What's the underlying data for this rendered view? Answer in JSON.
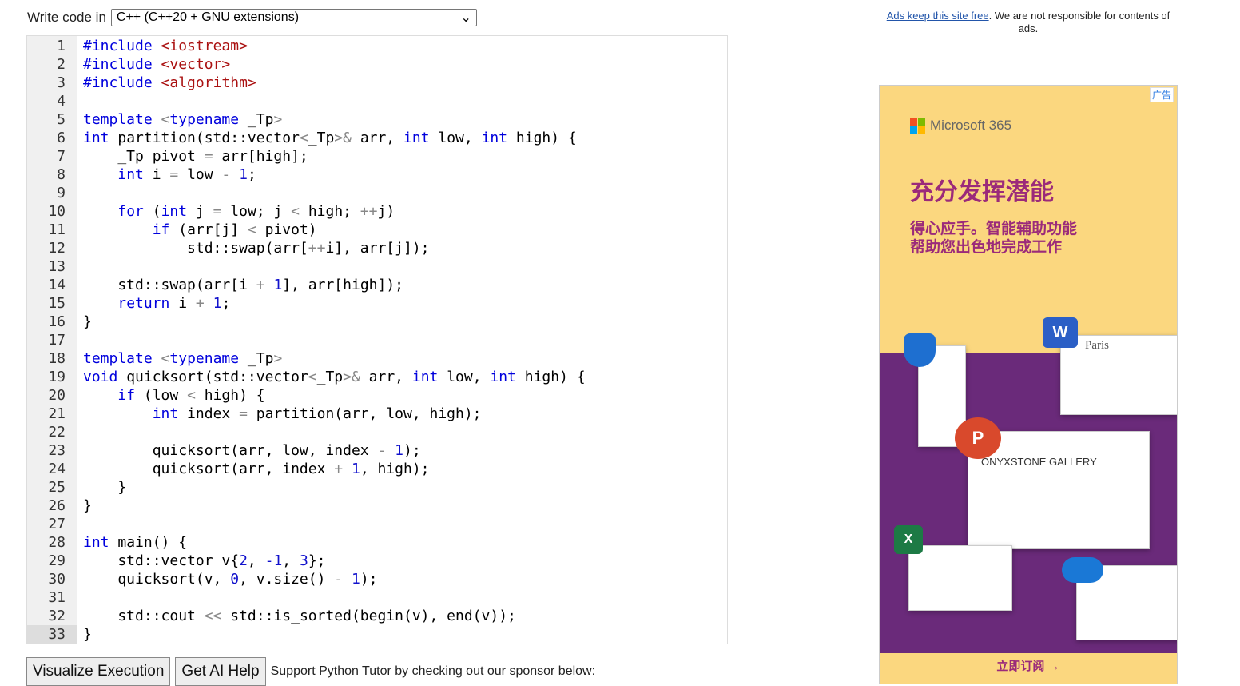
{
  "header": {
    "label": "Write code in",
    "language": "C++ (C++20 + GNU extensions)"
  },
  "editor": {
    "active_line": 33,
    "lines": [
      [
        [
          "k",
          "#include "
        ],
        [
          "s",
          "<iostream>"
        ]
      ],
      [
        [
          "k",
          "#include "
        ],
        [
          "s",
          "<vector>"
        ]
      ],
      [
        [
          "k",
          "#include "
        ],
        [
          "s",
          "<algorithm>"
        ]
      ],
      [],
      [
        [
          "k",
          "template "
        ],
        [
          "o",
          "<"
        ],
        [
          "k",
          "typename"
        ],
        [
          "p",
          " _Tp"
        ],
        [
          "o",
          ">"
        ]
      ],
      [
        [
          "k",
          "int"
        ],
        [
          "p",
          " partition(std::vector"
        ],
        [
          "o",
          "<"
        ],
        [
          "p",
          "_Tp"
        ],
        [
          "o",
          ">&"
        ],
        [
          "p",
          " arr, "
        ],
        [
          "k",
          "int"
        ],
        [
          "p",
          " low, "
        ],
        [
          "k",
          "int"
        ],
        [
          "p",
          " high) {"
        ]
      ],
      [
        [
          "p",
          "    _Tp pivot "
        ],
        [
          "o",
          "="
        ],
        [
          "p",
          " arr[high];"
        ]
      ],
      [
        [
          "p",
          "    "
        ],
        [
          "k",
          "int"
        ],
        [
          "p",
          " i "
        ],
        [
          "o",
          "="
        ],
        [
          "p",
          " low "
        ],
        [
          "o",
          "-"
        ],
        [
          "p",
          " "
        ],
        [
          "n",
          "1"
        ],
        [
          "p",
          ";"
        ]
      ],
      [],
      [
        [
          "p",
          "    "
        ],
        [
          "k",
          "for"
        ],
        [
          "p",
          " ("
        ],
        [
          "k",
          "int"
        ],
        [
          "p",
          " j "
        ],
        [
          "o",
          "="
        ],
        [
          "p",
          " low; j "
        ],
        [
          "o",
          "<"
        ],
        [
          "p",
          " high; "
        ],
        [
          "o",
          "++"
        ],
        [
          "p",
          "j)"
        ]
      ],
      [
        [
          "p",
          "        "
        ],
        [
          "k",
          "if"
        ],
        [
          "p",
          " (arr[j] "
        ],
        [
          "o",
          "<"
        ],
        [
          "p",
          " pivot)"
        ]
      ],
      [
        [
          "p",
          "            std::swap(arr["
        ],
        [
          "o",
          "++"
        ],
        [
          "p",
          "i], arr[j]);"
        ]
      ],
      [],
      [
        [
          "p",
          "    std::swap(arr[i "
        ],
        [
          "o",
          "+"
        ],
        [
          "p",
          " "
        ],
        [
          "n",
          "1"
        ],
        [
          "p",
          "], arr[high]);"
        ]
      ],
      [
        [
          "p",
          "    "
        ],
        [
          "k",
          "return"
        ],
        [
          "p",
          " i "
        ],
        [
          "o",
          "+"
        ],
        [
          "p",
          " "
        ],
        [
          "n",
          "1"
        ],
        [
          "p",
          ";"
        ]
      ],
      [
        [
          "p",
          "}"
        ]
      ],
      [],
      [
        [
          "k",
          "template "
        ],
        [
          "o",
          "<"
        ],
        [
          "k",
          "typename"
        ],
        [
          "p",
          " _Tp"
        ],
        [
          "o",
          ">"
        ]
      ],
      [
        [
          "k",
          "void"
        ],
        [
          "p",
          " quicksort(std::vector"
        ],
        [
          "o",
          "<"
        ],
        [
          "p",
          "_Tp"
        ],
        [
          "o",
          ">&"
        ],
        [
          "p",
          " arr, "
        ],
        [
          "k",
          "int"
        ],
        [
          "p",
          " low, "
        ],
        [
          "k",
          "int"
        ],
        [
          "p",
          " high) {"
        ]
      ],
      [
        [
          "p",
          "    "
        ],
        [
          "k",
          "if"
        ],
        [
          "p",
          " (low "
        ],
        [
          "o",
          "<"
        ],
        [
          "p",
          " high) {"
        ]
      ],
      [
        [
          "p",
          "        "
        ],
        [
          "k",
          "int"
        ],
        [
          "p",
          " index "
        ],
        [
          "o",
          "="
        ],
        [
          "p",
          " partition(arr, low, high);"
        ]
      ],
      [],
      [
        [
          "p",
          "        quicksort(arr, low, index "
        ],
        [
          "o",
          "-"
        ],
        [
          "p",
          " "
        ],
        [
          "n",
          "1"
        ],
        [
          "p",
          ");"
        ]
      ],
      [
        [
          "p",
          "        quicksort(arr, index "
        ],
        [
          "o",
          "+"
        ],
        [
          "p",
          " "
        ],
        [
          "n",
          "1"
        ],
        [
          "p",
          ", high);"
        ]
      ],
      [
        [
          "p",
          "    }"
        ]
      ],
      [
        [
          "p",
          "}"
        ]
      ],
      [],
      [
        [
          "k",
          "int"
        ],
        [
          "p",
          " main() {"
        ]
      ],
      [
        [
          "p",
          "    std::vector v{"
        ],
        [
          "n",
          "2"
        ],
        [
          "p",
          ", "
        ],
        [
          "n",
          "-1"
        ],
        [
          "p",
          ", "
        ],
        [
          "n",
          "3"
        ],
        [
          "p",
          "};"
        ]
      ],
      [
        [
          "p",
          "    quicksort(v, "
        ],
        [
          "n",
          "0"
        ],
        [
          "p",
          ", v.size() "
        ],
        [
          "o",
          "-"
        ],
        [
          "p",
          " "
        ],
        [
          "n",
          "1"
        ],
        [
          "p",
          ");"
        ]
      ],
      [],
      [
        [
          "p",
          "    std::cout "
        ],
        [
          "o",
          "<<"
        ],
        [
          "p",
          " std::is_sorted(begin(v), end(v));"
        ]
      ],
      [
        [
          "p",
          "}"
        ]
      ]
    ]
  },
  "buttons": {
    "visualize": "Visualize Execution",
    "ai_help": "Get AI Help",
    "sponsor_text": "Support Python Tutor by checking out our sponsor below:"
  },
  "ad_note": {
    "link": "Ads keep this site free",
    "text": ". We are not responsible for contents of ads."
  },
  "ad": {
    "label": "广告",
    "brand": "Microsoft 365",
    "headline": "充分发挥潜能",
    "sub1": "得心应手。智能辅助功能",
    "sub2": "帮助您出色地完成工作",
    "cta": "立即订阅 →",
    "gallery_text": "ONYXSTONE GALLERY",
    "paris_text": "Paris"
  }
}
